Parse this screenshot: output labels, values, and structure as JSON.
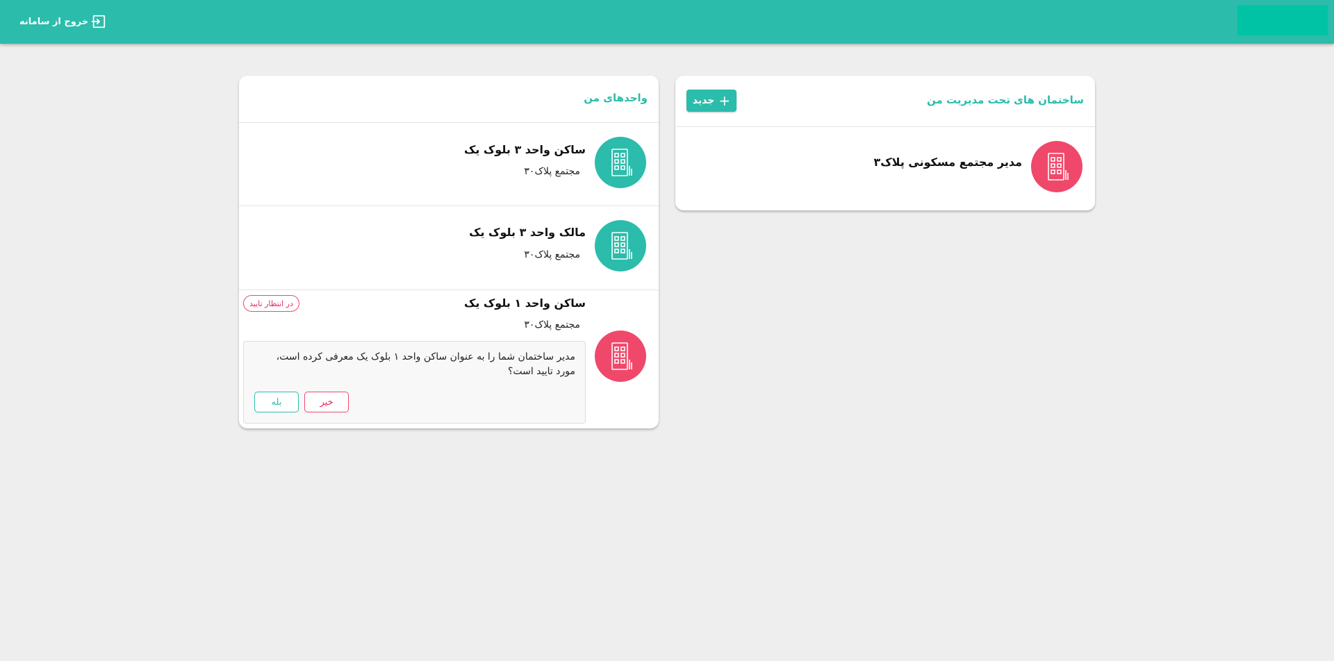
{
  "header": {
    "logout_label": "خروج از سامانه",
    "logout_icon": "logout-icon"
  },
  "managed_buildings": {
    "title": "ساختمان های تحت مدیریت من",
    "new_button_label": "جدید",
    "items": [
      {
        "title": "مدیر مجتمع مسکونی پلاک۳",
        "avatar_color": "#f0486a",
        "icon": "building-icon"
      }
    ]
  },
  "my_units": {
    "title": "واحدهای من",
    "items": [
      {
        "title": "ساکن واحد ۳ بلوک یک",
        "subtitle": "مجتمع پلاک۳۰",
        "avatar_color": "#2bbcab",
        "icon": "building-icon"
      },
      {
        "title": "مالک واحد ۳ بلوک یک",
        "subtitle": "مجتمع پلاک۳۰",
        "avatar_color": "#2bbcab",
        "icon": "building-icon"
      },
      {
        "title": "ساکن واحد ۱ بلوک یک",
        "subtitle": "مجتمع پلاک۳۰",
        "avatar_color": "#f0486a",
        "icon": "building-icon",
        "status_badge": "در انتظار تایید",
        "confirm_message": "مدیر ساختمان شما را به عنوان ساکن واحد ۱ بلوک یک  معرفی کرده است، مورد تایید است؟",
        "no_label": "خیر",
        "yes_label": "بله"
      }
    ]
  },
  "colors": {
    "primary": "#2bbcab",
    "danger": "#f0486a",
    "background": "#eeeeee"
  }
}
